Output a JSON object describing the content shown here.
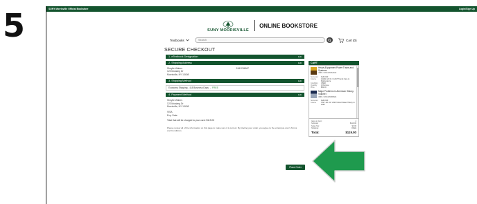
{
  "step_number": "5",
  "colors": {
    "brand_green": "#13542e",
    "arrow_green": "#1f9a4e",
    "ship_cost": "#2d8a3c"
  },
  "topbar": {
    "left": "SUNY Morrisville Official Bookstore",
    "right": "Login/Sign Up"
  },
  "logo": {
    "seal_text": "SUNY MORRISVILLE",
    "store_title": "ONLINE BOOKSTORE",
    "icon": "tree-seal-logo"
  },
  "nav": {
    "textbooks_label": "Textbooks",
    "search_placeholder": "Search",
    "cart_label": "Cart (0)"
  },
  "checkout": {
    "title": "SECURE CHECKOUT",
    "edit_label": "Edit",
    "sections": {
      "designation": "1. eTextbook Designation",
      "shipping_address": "2. Shipping Address",
      "shipping_method": "3. Shipping Method",
      "payment_method": "4. Payment Method"
    },
    "address": {
      "name": "Sheylie Waters",
      "street": "123 Mustang Dr",
      "city": "Morrisville, NY 13408",
      "phone": "5161234567"
    },
    "shipping": {
      "method": "Economy Shipping - 4-8 Business Days",
      "cost": "FREE"
    },
    "payment": {
      "name": "Sheylie Waters",
      "street": "123 Mustang Dr",
      "city": "Morrisville, NY 13408",
      "card": "VISA",
      "exp": "Exp. Date:"
    },
    "total_charged": "Total that will be charged to your card: $119.00",
    "review_text": "Please review all of the information on this page to make sure it is correct. By placing your order, you agree to the eCampus.com's Terms and Conditions.",
    "place_order_label": "Place Order"
  },
  "cart": {
    "header": "CART",
    "items": [
      {
        "title": "Heavy Equipment Power Trains and Systems",
        "isbn": "ISBN: 9781305952669",
        "meta": [
          [
            "Semester",
            "Fall 2020"
          ],
          [
            "Course",
            "AGEN 122 01 / CAST Transit Care & Maintenance"
          ],
          [
            "Condition",
            "USED"
          ],
          [
            "Quantity",
            "1 Remove"
          ],
          [
            "Price",
            "$81.00"
          ]
        ]
      },
      {
        "title": "Major Problems in American History, Volume I",
        "isbn": "ISBN: 9781305585584",
        "meta": [
          [
            "Semester",
            "Fall 2020"
          ],
          [
            "Course",
            "HIST 101 02 / 2020 United States History to 1865"
          ]
        ]
      }
    ],
    "summary": {
      "items_label": "Items in Cart:",
      "items_value": "2",
      "subtotal_label": "Subtotal:",
      "subtotal_value": "$119.00",
      "tax_label": "Sales Tax:",
      "tax_value": "$0.00",
      "shipping_label": "Shipping:",
      "shipping_value": "FREE",
      "total_label": "Total:",
      "total_value": "$119.00"
    }
  }
}
